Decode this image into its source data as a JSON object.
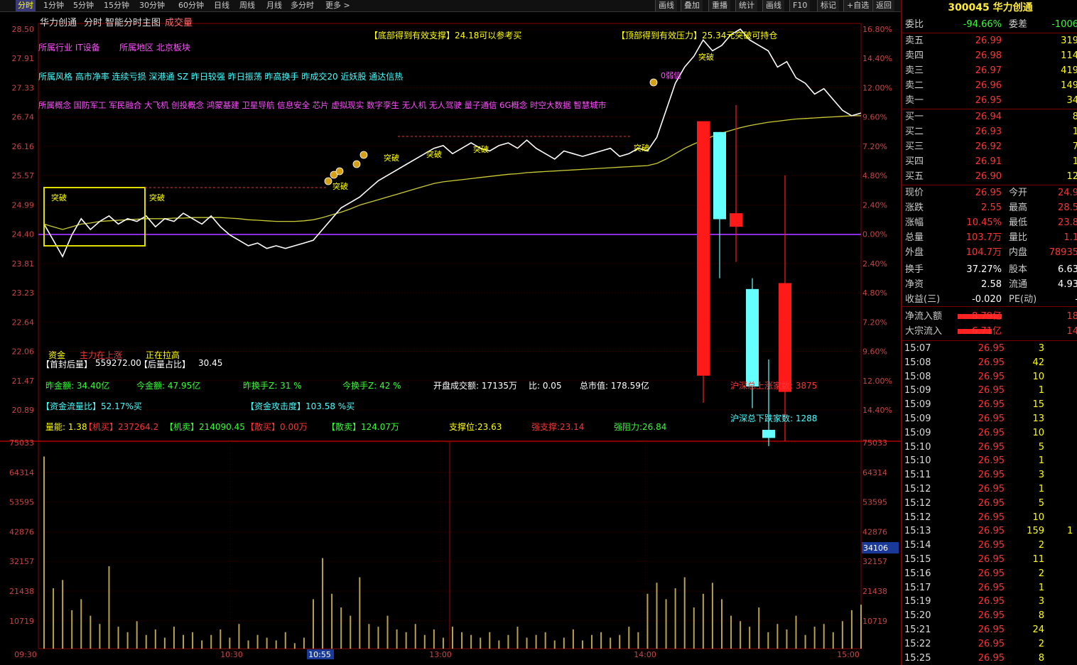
{
  "toolbar": {
    "tabs": [
      "分时",
      "1分钟",
      "5分钟",
      "15分钟",
      "30分钟",
      "60分钟",
      "日线",
      "周线",
      "月线",
      "多分时",
      "更多 >"
    ],
    "active_tab": "分时",
    "right_buttons": [
      "画线",
      "叠加",
      "重播",
      "统计",
      "画线",
      "F10",
      "标记",
      "+自选",
      "返回"
    ]
  },
  "chart_header": {
    "stock_name": "华力创通",
    "mode": "分时",
    "indicator": "智能分时主图",
    "volume_label": "成交量"
  },
  "price_axis": {
    "left": [
      "28.50",
      "27.91",
      "27.33",
      "26.74",
      "26.16",
      "25.57",
      "24.99",
      "24.40",
      "23.81",
      "23.23",
      "22.64",
      "22.06",
      "21.47",
      "20.89"
    ],
    "right": [
      "16.80%",
      "14.40%",
      "12.00%",
      "9.60%",
      "7.20%",
      "4.80%",
      "2.40%",
      "0.00%",
      "2.40%",
      "4.80%",
      "7.20%",
      "9.60%",
      "12.00%",
      "14.40%"
    ]
  },
  "volume_axis": {
    "labels": [
      "75033",
      "64314",
      "53595",
      "42876",
      "32157",
      "21438",
      "10719"
    ],
    "highlight": "34106"
  },
  "time_axis": {
    "labels": [
      "09:30",
      "10:30",
      "10:55",
      "13:00",
      "14:00",
      "15:00"
    ],
    "cursor": "10:55"
  },
  "annotations": {
    "support_note": "【底部得到有效支撑】24.18可以参考买",
    "resistance_note": "【顶部得到有效压力】25.34元突破可持仓",
    "industry": "所属行业  IT设备",
    "region": "所属地区  北京板块",
    "style": "所属风格  高市净率  连续亏损  深港通 SZ 昨日较强 昨日振荡 昨高换手 昨成交20 近妖股 通达信热",
    "concepts": "所属概念  国防军工  军民融合  大飞机  创投概念  鸿蒙基建  卫星导航  信息安全  芯片  虚拟现实  数字孪生  无人机  无人驾驶  量子通信  6G概念  时空大数据  智慧城市",
    "breakout": "突破",
    "weak_signal": "0弱信",
    "funds_label": "资金",
    "main_force": "主力在上涨",
    "pulling_up": "正在拉高"
  },
  "indicator_rows": {
    "first_seal_label": "【首封后量】",
    "first_seal_value": "559272.00",
    "seal_ratio_label": "【后量占比】",
    "seal_ratio_value": "30.45",
    "yesterday_amount": "昨金额: 34.40亿",
    "today_amount": "今金额: 47.95亿",
    "yesterday_turnover": "昨换手Z: 31  %",
    "today_turnover": "今换手Z: 42  %",
    "open_volume": "开盘成交额: 17135万",
    "ratio": "比: 0.05",
    "market_cap": "总市值: 178.59亿",
    "sh_up": "沪深总上涨家数: 3875",
    "sh_down": "沪深总下跌家数: 1288",
    "fund_flow": "【资金流量比】52.17%买",
    "fund_attack": "【资金攻击度】103.58 %买",
    "qty": "量能: 1.38",
    "inst_buy": "【机买】237264.2",
    "inst_sell": "【机卖】214090.45",
    "retail_sell": "【散买】0.00万",
    "retail_buy": "【散卖】124.07万",
    "support": "支撑位:23.63",
    "strong_support": "强支撑:23.14",
    "resistance": "强阻力:26.84"
  },
  "quote_panel": {
    "title": "300045 华力创通",
    "weibi_label": "委比",
    "weibi_value": "-94.66%",
    "weicha_label": "委差",
    "weicha_value": "-1006",
    "asks": [
      {
        "label": "卖五",
        "price": "26.99",
        "vol": "319"
      },
      {
        "label": "卖四",
        "price": "26.98",
        "vol": "114"
      },
      {
        "label": "卖三",
        "price": "26.97",
        "vol": "419"
      },
      {
        "label": "卖二",
        "price": "26.96",
        "vol": "149"
      },
      {
        "label": "卖一",
        "price": "26.95",
        "vol": "34"
      }
    ],
    "bids": [
      {
        "label": "买一",
        "price": "26.94",
        "vol": "8"
      },
      {
        "label": "买二",
        "price": "26.93",
        "vol": "1"
      },
      {
        "label": "买三",
        "price": "26.92",
        "vol": "7"
      },
      {
        "label": "买四",
        "price": "26.91",
        "vol": "1"
      },
      {
        "label": "买五",
        "price": "26.90",
        "vol": "12"
      }
    ],
    "stats": [
      {
        "k": "现价",
        "v": "26.95",
        "k2": "今开",
        "v2": "24.9"
      },
      {
        "k": "涨跌",
        "v": "2.55",
        "k2": "最高",
        "v2": "28.5"
      },
      {
        "k": "涨幅",
        "v": "10.45%",
        "k2": "最低",
        "v2": "23.8"
      },
      {
        "k": "总量",
        "v": "103.7万",
        "k2": "量比",
        "v2": "1.1"
      },
      {
        "k": "外盘",
        "v": "104.7万",
        "k2": "内盘",
        "v2": "78935"
      },
      {
        "k": "换手",
        "v": "37.27%",
        "k2": "股本",
        "v2": "6.63"
      },
      {
        "k": "净资",
        "v": "2.58",
        "k2": "流通",
        "v2": "4.93"
      },
      {
        "k": "收益(三)",
        "v": "-0.020",
        "k2": "PE(动)",
        "v2": "-"
      }
    ],
    "flows": [
      {
        "k": "净流入额",
        "v": "8.79亿",
        "v2": "18"
      },
      {
        "k": "大宗流入",
        "v": "6.71亿",
        "v2": "14"
      }
    ],
    "ticks": [
      {
        "t": "15:07",
        "p": "26.95",
        "q": "3",
        "e": ""
      },
      {
        "t": "15:08",
        "p": "26.95",
        "q": "42",
        "e": ""
      },
      {
        "t": "15:08",
        "p": "26.95",
        "q": "10",
        "e": ""
      },
      {
        "t": "15:09",
        "p": "26.95",
        "q": "1",
        "e": ""
      },
      {
        "t": "15:09",
        "p": "26.95",
        "q": "15",
        "e": ""
      },
      {
        "t": "15:09",
        "p": "26.95",
        "q": "13",
        "e": ""
      },
      {
        "t": "15:09",
        "p": "26.95",
        "q": "10",
        "e": ""
      },
      {
        "t": "15:10",
        "p": "26.95",
        "q": "5",
        "e": ""
      },
      {
        "t": "15:10",
        "p": "26.95",
        "q": "1",
        "e": ""
      },
      {
        "t": "15:11",
        "p": "26.95",
        "q": "3",
        "e": ""
      },
      {
        "t": "15:12",
        "p": "26.95",
        "q": "1",
        "e": ""
      },
      {
        "t": "15:12",
        "p": "26.95",
        "q": "5",
        "e": ""
      },
      {
        "t": "15:12",
        "p": "26.95",
        "q": "10",
        "e": ""
      },
      {
        "t": "15:13",
        "p": "26.95",
        "q": "159",
        "e": "1"
      },
      {
        "t": "15:14",
        "p": "26.95",
        "q": "2",
        "e": ""
      },
      {
        "t": "15:15",
        "p": "26.95",
        "q": "11",
        "e": ""
      },
      {
        "t": "15:16",
        "p": "26.95",
        "q": "2",
        "e": ""
      },
      {
        "t": "15:17",
        "p": "26.95",
        "q": "1",
        "e": ""
      },
      {
        "t": "15:19",
        "p": "26.95",
        "q": "3",
        "e": ""
      },
      {
        "t": "15:20",
        "p": "26.95",
        "q": "8",
        "e": ""
      },
      {
        "t": "15:21",
        "p": "26.95",
        "q": "24",
        "e": ""
      },
      {
        "t": "15:22",
        "p": "26.95",
        "q": "2",
        "e": ""
      },
      {
        "t": "15:25",
        "p": "26.95",
        "q": "8",
        "e": ""
      }
    ]
  },
  "chart_data": {
    "type": "line",
    "price_range": [
      20.89,
      28.5
    ],
    "prev_close": 24.4,
    "price": [
      24.9,
      24.6,
      24.3,
      24.7,
      25.0,
      24.8,
      24.95,
      25.05,
      24.9,
      25.0,
      24.95,
      25.05,
      24.85,
      25.0,
      24.95,
      25.1,
      25.0,
      24.9,
      25.05,
      24.85,
      24.7,
      24.6,
      24.5,
      24.55,
      24.45,
      24.5,
      24.45,
      24.5,
      24.55,
      24.6,
      24.8,
      25.0,
      25.2,
      25.3,
      25.4,
      25.55,
      25.7,
      25.8,
      25.9,
      26.0,
      26.1,
      26.2,
      26.3,
      26.35,
      26.2,
      26.3,
      26.4,
      26.3,
      26.25,
      26.35,
      26.4,
      26.3,
      26.45,
      26.3,
      26.2,
      26.1,
      26.25,
      26.2,
      26.15,
      26.2,
      26.25,
      26.3,
      26.15,
      26.2,
      26.3,
      26.25,
      26.5,
      27.0,
      27.5,
      27.8,
      28.0,
      28.3,
      28.1,
      28.2,
      28.4,
      28.5,
      28.3,
      28.2,
      28.1,
      27.8,
      27.9,
      27.6,
      27.5,
      27.3,
      27.4,
      27.2,
      27.0,
      26.9,
      26.95
    ],
    "avg": [
      24.9,
      24.85,
      24.8,
      24.85,
      24.9,
      24.92,
      24.95,
      24.96,
      24.97,
      24.98,
      24.99,
      25.0,
      25.0,
      25.0,
      25.01,
      25.01,
      25.02,
      25.02,
      25.02,
      25.02,
      25.01,
      25.0,
      24.98,
      24.97,
      24.96,
      24.95,
      24.95,
      24.95,
      24.96,
      24.98,
      25.02,
      25.07,
      25.12,
      25.18,
      25.25,
      25.3,
      25.35,
      25.4,
      25.45,
      25.5,
      25.55,
      25.6,
      25.65,
      25.68,
      25.7,
      25.72,
      25.74,
      25.76,
      25.78,
      25.8,
      25.82,
      25.83,
      25.85,
      25.86,
      25.87,
      25.88,
      25.89,
      25.9,
      25.91,
      25.92,
      25.93,
      25.94,
      25.95,
      25.96,
      25.97,
      25.98,
      26.02,
      26.1,
      26.2,
      26.3,
      26.38,
      26.45,
      26.52,
      26.58,
      26.63,
      26.68,
      26.72,
      26.75,
      26.78,
      26.8,
      26.82,
      26.84,
      26.85,
      26.86,
      26.87,
      26.88,
      26.89,
      26.9,
      26.9
    ],
    "volume": [
      70000,
      22000,
      25000,
      14000,
      18000,
      12000,
      9000,
      30000,
      8000,
      6000,
      10000,
      5000,
      7000,
      4000,
      8000,
      5000,
      6000,
      3000,
      5000,
      7000,
      4000,
      9000,
      3000,
      5000,
      4000,
      3000,
      6000,
      2000,
      4000,
      18000,
      33000,
      20000,
      15000,
      12000,
      26000,
      9000,
      8000,
      12000,
      7000,
      6000,
      9000,
      5000,
      7000,
      4000,
      8000,
      6000,
      5000,
      4000,
      6000,
      3000,
      5000,
      8000,
      4000,
      5000,
      6000,
      3000,
      4000,
      7000,
      3000,
      5000,
      6000,
      4000,
      5000,
      8000,
      6000,
      20000,
      24000,
      18000,
      22000,
      26000,
      15000,
      20000,
      24000,
      18000,
      12000,
      10000,
      8000,
      15000,
      6000,
      9000,
      7000,
      12000,
      5000,
      8000,
      9000,
      6000,
      10000,
      14000,
      16000
    ]
  },
  "candles": [
    {
      "open": 26.8,
      "close": 22.1,
      "high": 26.8,
      "low": 21.6,
      "color": "#ff1a1a"
    },
    {
      "open": 26.6,
      "close": 24.99,
      "high": 26.6,
      "low": 23.9,
      "color": "#6ff"
    },
    {
      "open": 25.1,
      "close": 24.85,
      "high": 27.1,
      "low": 24.2,
      "color": "#ff1a1a"
    },
    {
      "open": 23.7,
      "close": 21.9,
      "high": 23.9,
      "low": 21.5,
      "color": "#6ff"
    },
    {
      "open": 21.1,
      "close": 20.95,
      "high": 22.4,
      "low": 20.8,
      "color": "#6ff"
    },
    {
      "open": 21.8,
      "close": 23.81,
      "high": 25.8,
      "low": 20.89,
      "color": "#ff1a1a"
    }
  ]
}
